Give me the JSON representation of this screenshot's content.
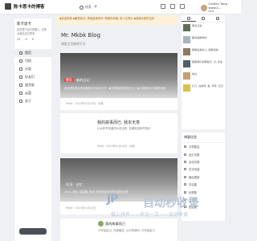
{
  "brand": {
    "name": "陈卡思卡的博客"
  },
  "search": {
    "placeholder": "搜索"
  },
  "user": {
    "line1": "Caitlen Tong · www.k...",
    "line2": "Lv1"
  },
  "profile": {
    "name": "陈卡思卡",
    "bio": "走在属于自己的路上, 记录点滴生活与思考",
    "stats": [
      "23",
      "0",
      "5"
    ]
  },
  "nav": [
    {
      "label": "首页",
      "active": true
    },
    {
      "label": "归档"
    },
    {
      "label": "分类"
    },
    {
      "label": "好友们"
    },
    {
      "label": "留言板"
    },
    {
      "label": "云盘"
    },
    {
      "label": "关于"
    }
  ],
  "notice": "◆欢迎来我 ◆备受各方, 希望我身体好, 希望你幸福, 祝人生快乐 ◆感谢大家的支持",
  "blog": {
    "title": "Mr. Mkbk Blog",
    "subtitle": "博客主页随便写写"
  },
  "posts": {
    "p1": {
      "tag": "置顶",
      "title": "新的日记",
      "excerpt": "我这都是我经历的路程中的真实文字, 每次更新都是我的日记, 每天更新的文字都是真实",
      "meta": "Mkbk · 2023年01月10日 · 阅读"
    },
    "p2": {
      "title": "我的故事而已, 我本无意",
      "excerpt": "小伙伴不知道怎么说出来, 没遇到这种不快乐",
      "meta": "Mkbk · 2023年01月10日 · 阅读"
    },
    "p3": {
      "title": "近况 · 记忆",
      "excerpt": "2021, 我们, 最温暖, 我记, 我们的友情的时光都在这里",
      "meta": "Mkbk · 2023年01月10日"
    },
    "p4": {
      "title": "我的故事而已",
      "excerpt": "只写给自己, 在我朋友, 心中有我吗, 只写给自己"
    }
  },
  "recent": [
    {
      "text": "再见日常"
    },
    {
      "text": "都叫我那样的"
    },
    {
      "text": "致敬后来的人, 致敬来的"
    },
    {
      "text": "致敬我们的那些日, 记, 还会"
    },
    {
      "text": "地过"
    },
    {
      "text": "打几, 在新增, 发, 年年, 日日"
    }
  ],
  "widget": {
    "title": "博客信息",
    "items": [
      "文章数目",
      "运行天数",
      "全站字数",
      "总访问量",
      "最后更新",
      "评论数",
      "标签数",
      "分类数",
      "友链数"
    ]
  },
  "watermark": {
    "logo": "JP",
    "text": "自动秒收录",
    "sub": "做上排名——来访一次——自动收录"
  },
  "colors": {
    "accent": "#e04b4b",
    "notice_bg": "#fdf1d9",
    "notice_text": "#9a6b21"
  },
  "icons": [
    "search-icon",
    "plus-icon",
    "bell-icon",
    "mail-icon",
    "grid-icon",
    "home-icon"
  ]
}
